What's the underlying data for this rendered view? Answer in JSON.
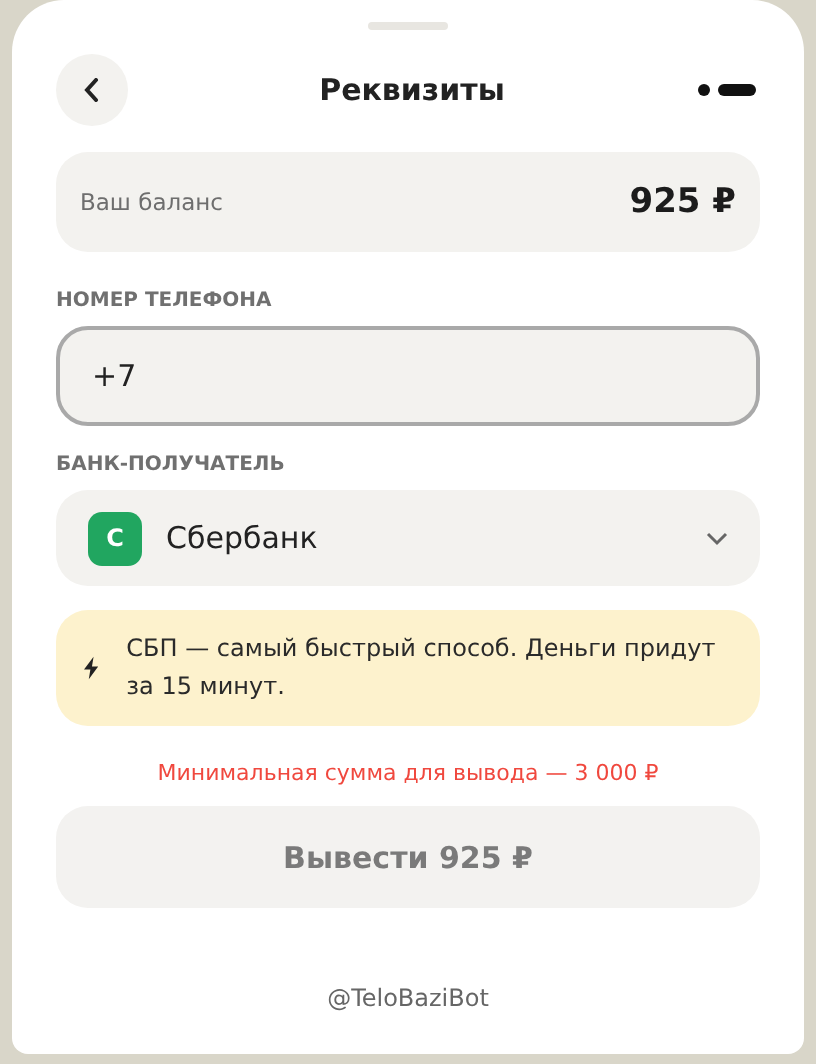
{
  "header": {
    "title": "Реквизиты"
  },
  "balance": {
    "label": "Ваш баланс",
    "amount": "925 ₽"
  },
  "phone": {
    "label": "НОМЕР ТЕЛЕФОНА",
    "value": "+7",
    "focused": true
  },
  "bank": {
    "label": "БАНК-ПОЛУЧАТЕЛЬ",
    "badge": "С",
    "name": "Сбербанк",
    "color": "#21a660"
  },
  "notice": {
    "text": "СБП — самый быстрый способ. Деньги придут за 15 минут."
  },
  "warning": "Минимальная сумма для вывода — 3 000 ₽",
  "submit": {
    "label": "Вывести 925 ₽",
    "disabled": true
  },
  "footer": "@TeloBaziBot"
}
